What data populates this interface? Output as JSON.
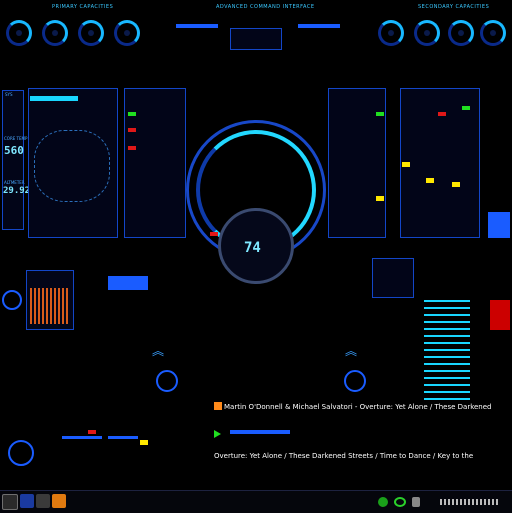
{
  "header": {
    "left_title": "PRIMARY CAPACITIES",
    "center_title": "ADVANCED COMMAND INTERFACE",
    "right_title": "SECONDARY CAPACITIES"
  },
  "left_panel": {
    "top_label": "SYS",
    "counter_label": "CORE TEMP",
    "counter_value": "560",
    "alt_label": "ALTMETER",
    "alt_value": "29.92"
  },
  "center_display": {
    "value": "74"
  },
  "media": {
    "artist_track": "Martin O'Donnell & Michael Salvatori - Overture: Yet Alone / These Darkened Streets / Time to",
    "ticker": "Overture: Yet Alone / These Darkened Streets / Time to Dance / Key to the Ci..."
  },
  "colors": {
    "accent": "#1a5cff",
    "cyan": "#19d6ff",
    "alert": "#e01818",
    "ok": "#20e020",
    "warn": "#ffe800"
  }
}
